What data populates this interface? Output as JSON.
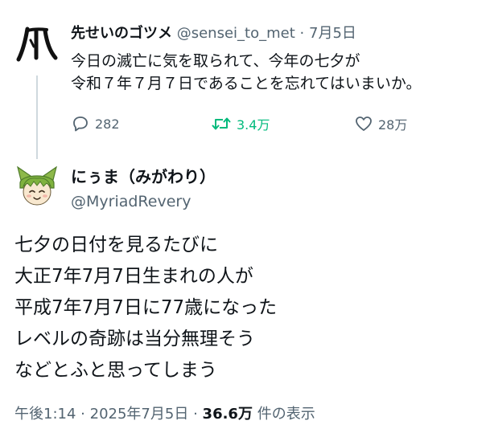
{
  "quoted_tweet": {
    "author_name": "先せいのゴツメ",
    "handle": "@sensei_to_met",
    "separator": "·",
    "date": "7月5日",
    "text_lines": [
      "今日の滅亡に気を取られて、今年の七夕が",
      "令和７年７月７日であることを忘れてはいまいか。"
    ],
    "replies": "282",
    "retweets": "3.4万",
    "likes": "28万",
    "avatar_glyph": "爪"
  },
  "main_tweet": {
    "author_name": "にぅま（みがわり）",
    "handle": "@MyriadRevery",
    "text_lines": [
      "七夕の日付を見るたびに",
      "大正7年7月7日生まれの人が",
      "平成7年7月7日に77歳になった",
      "レベルの奇跡は当分無理そう",
      "などとふと思ってしまう"
    ],
    "time": "午後1:14",
    "separator": "·",
    "date": "2025年7月5日",
    "views_count": "36.6万",
    "views_label": "件の表示"
  },
  "icons": {
    "reply": "reply-icon",
    "retweet": "retweet-icon",
    "like": "heart-icon"
  },
  "colors": {
    "text": "#0f1419",
    "secondary": "#536471",
    "retweet_green": "#00ba7c",
    "thread_line": "#cfd9de"
  }
}
